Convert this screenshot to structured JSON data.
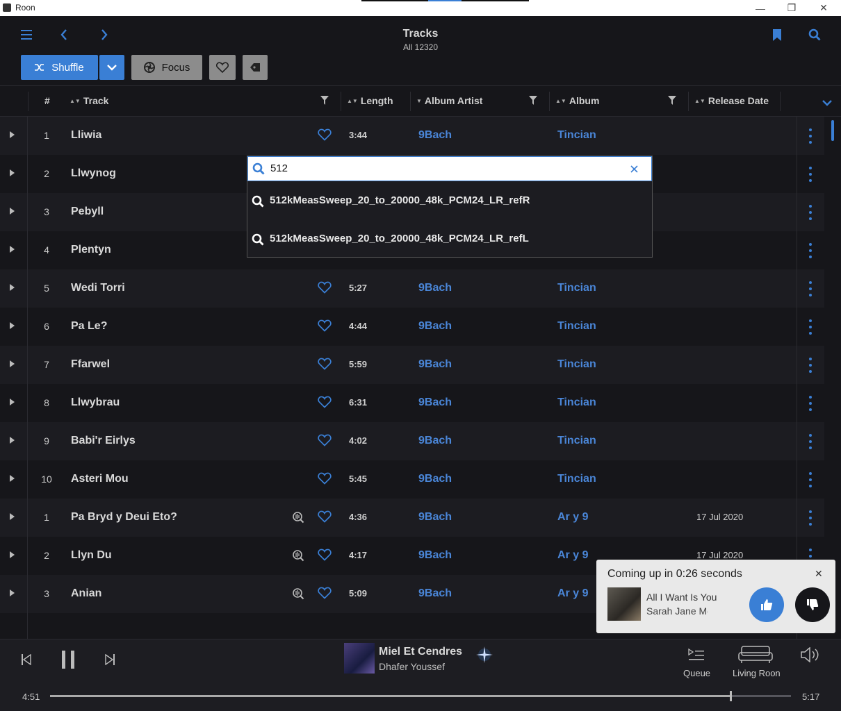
{
  "window": {
    "title": "Roon"
  },
  "header": {
    "title": "Tracks",
    "subtitle": "All 12320"
  },
  "toolbar": {
    "shuffle_label": "Shuffle",
    "focus_label": "Focus"
  },
  "columns": {
    "number": "#",
    "track": "Track",
    "length": "Length",
    "album_artist": "Album Artist",
    "album": "Album",
    "release_date": "Release Date"
  },
  "rows": [
    {
      "num": "1",
      "track": "Lliwia",
      "length": "3:44",
      "artist": "9Bach",
      "album": "Tincian",
      "date": "",
      "scan": false
    },
    {
      "num": "2",
      "track": "Llwynog",
      "length": "",
      "artist": "",
      "album": "",
      "date": "",
      "scan": false
    },
    {
      "num": "3",
      "track": "Pebyll",
      "length": "",
      "artist": "",
      "album": "",
      "date": "",
      "scan": false
    },
    {
      "num": "4",
      "track": "Plentyn",
      "length": "",
      "artist": "",
      "album": "",
      "date": "",
      "scan": false
    },
    {
      "num": "5",
      "track": "Wedi Torri",
      "length": "5:27",
      "artist": "9Bach",
      "album": "Tincian",
      "date": "",
      "scan": false
    },
    {
      "num": "6",
      "track": "Pa Le?",
      "length": "4:44",
      "artist": "9Bach",
      "album": "Tincian",
      "date": "",
      "scan": false
    },
    {
      "num": "7",
      "track": "Ffarwel",
      "length": "5:59",
      "artist": "9Bach",
      "album": "Tincian",
      "date": "",
      "scan": false
    },
    {
      "num": "8",
      "track": "Llwybrau",
      "length": "6:31",
      "artist": "9Bach",
      "album": "Tincian",
      "date": "",
      "scan": false
    },
    {
      "num": "9",
      "track": "Babi'r Eirlys",
      "length": "4:02",
      "artist": "9Bach",
      "album": "Tincian",
      "date": "",
      "scan": false
    },
    {
      "num": "10",
      "track": "Asteri Mou",
      "length": "5:45",
      "artist": "9Bach",
      "album": "Tincian",
      "date": "",
      "scan": false
    },
    {
      "num": "1",
      "track": "Pa Bryd y Deui Eto?",
      "length": "4:36",
      "artist": "9Bach",
      "album": "Ar y 9",
      "date": "17 Jul 2020",
      "scan": true
    },
    {
      "num": "2",
      "track": "Llyn Du",
      "length": "4:17",
      "artist": "9Bach",
      "album": "Ar y 9",
      "date": "17 Jul 2020",
      "scan": true
    },
    {
      "num": "3",
      "track": "Anian",
      "length": "5:09",
      "artist": "9Bach",
      "album": "Ar y 9",
      "date": "",
      "scan": true
    }
  ],
  "search": {
    "value": "512",
    "results": [
      "512kMeasSweep_20_to_20000_48k_PCM24_LR_refR",
      "512kMeasSweep_20_to_20000_48k_PCM24_LR_refL"
    ]
  },
  "toast": {
    "title": "Coming up in 0:26 seconds",
    "song": "All I Want Is You",
    "artist": "Sarah Jane Morris"
  },
  "player": {
    "title": "Miel Et Cendres",
    "artist": "Dhafer Youssef",
    "queue_label": "Queue",
    "zone_label": "Living Roon",
    "elapsed": "4:51",
    "total": "5:17",
    "progress": 0.918
  },
  "colors": {
    "accent": "#3a7fd5",
    "background": "#16161a",
    "row_alt": "#1c1c21"
  }
}
